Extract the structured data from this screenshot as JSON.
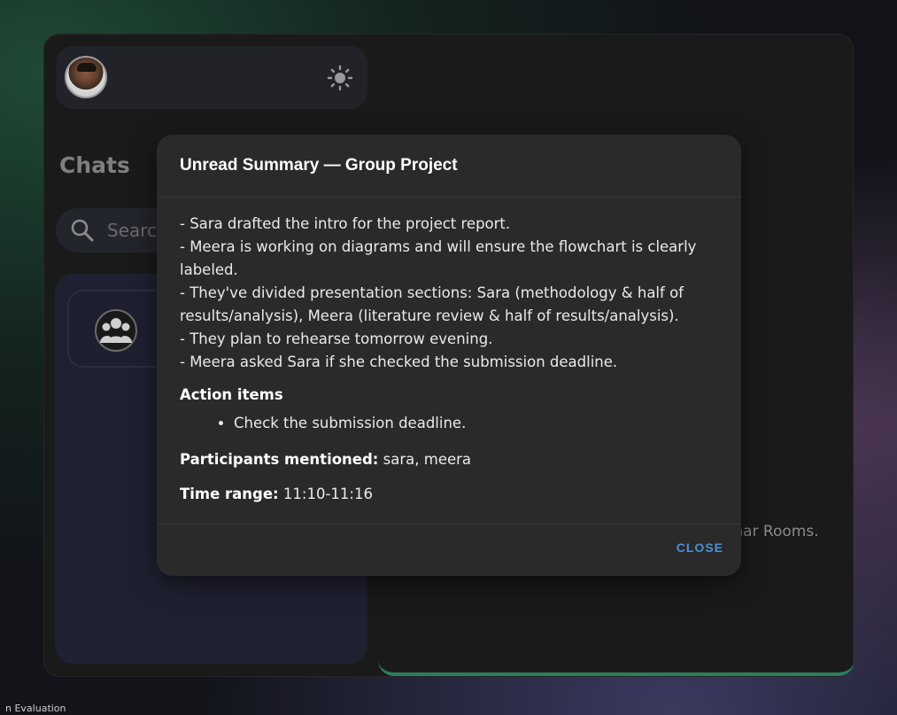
{
  "sidebar": {
    "title": "Chats",
    "search_placeholder": "Search"
  },
  "main": {
    "placeholder_text": "char Rooms."
  },
  "bottom_strip_text": "n Evaluation",
  "dialog": {
    "title": "Unread Summary — Group Project",
    "summary_lines": [
      "- Sara drafted the intro for the project report.",
      "- Meera is working on diagrams and will ensure the flowchart is clearly labeled.",
      "- They've divided presentation sections: Sara (methodology & half of results/analysis), Meera (literature review & half of results/analysis).",
      "- They plan to rehearse tomorrow evening.",
      "- Meera asked Sara if she checked the submission deadline."
    ],
    "action_items_heading": "Action items",
    "action_items": [
      "Check the submission deadline."
    ],
    "participants_label": "Participants mentioned:",
    "participants_value": "sara, meera",
    "time_range_label": "Time range:",
    "time_range_value": "11:10-11:16",
    "close_label": "CLOSE"
  },
  "colors": {
    "accent": "#4a90d9",
    "panel_border": "#2e7d5a"
  }
}
